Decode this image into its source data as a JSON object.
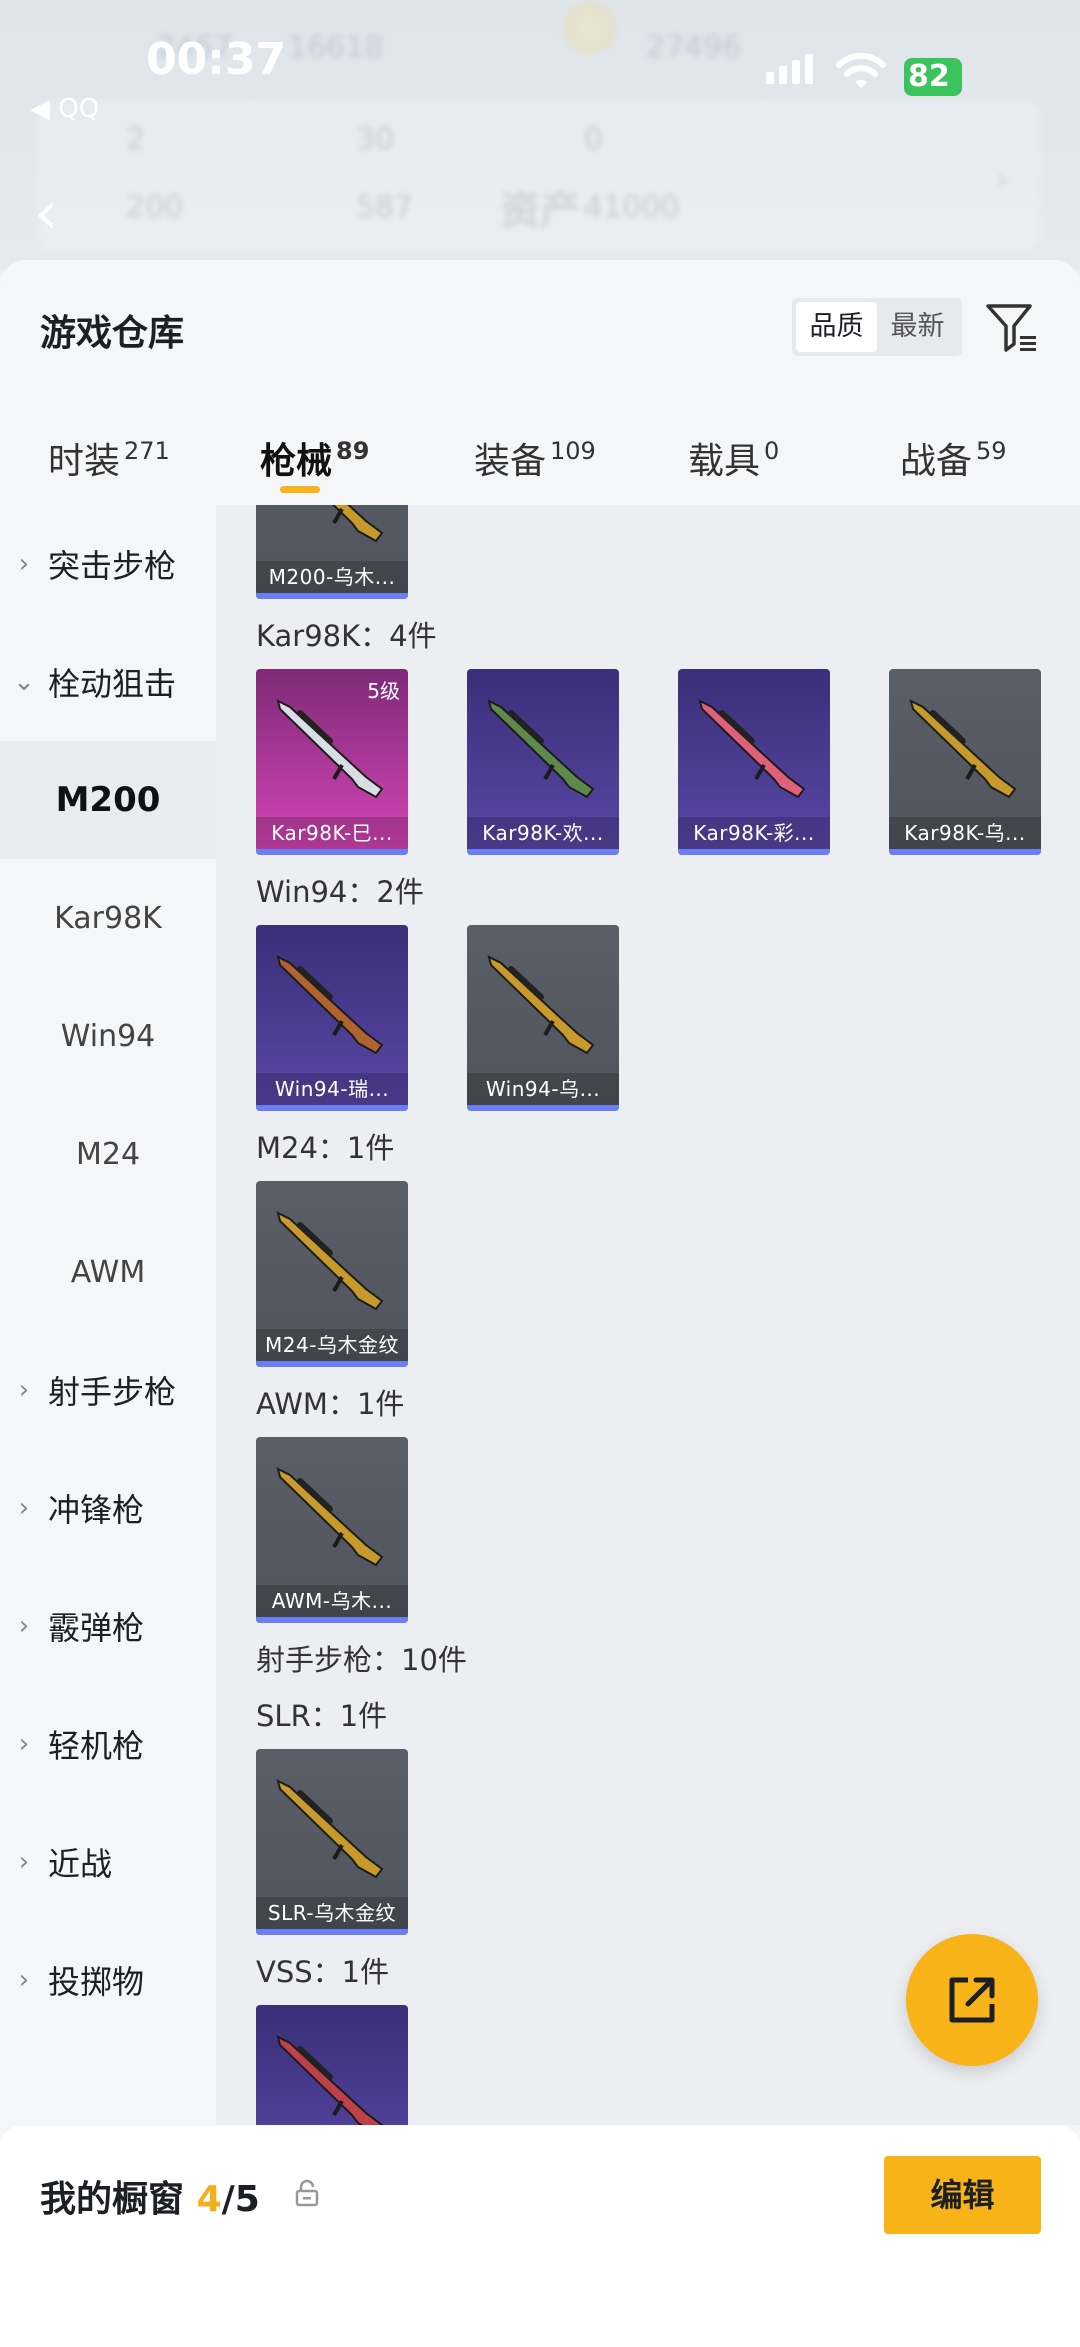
{
  "status_bar": {
    "time": "00:37",
    "back_app": "◀ QQ",
    "battery": "82"
  },
  "background_header": {
    "stats_row1": [
      "2",
      "30",
      "0"
    ],
    "stats_row2": [
      "200",
      "587"
    ],
    "assets_label": "资产",
    "assets_value": "41000",
    "top_values": [
      "2467",
      "16618",
      "27496"
    ]
  },
  "header": {
    "title": "游戏仓库",
    "sort_options": [
      "品质",
      "最新"
    ],
    "active_sort": "品质"
  },
  "tabs": [
    {
      "label": "时装",
      "count": "271"
    },
    {
      "label": "枪械",
      "count": "89"
    },
    {
      "label": "装备",
      "count": "109"
    },
    {
      "label": "载具",
      "count": "0"
    },
    {
      "label": "战备",
      "count": "59"
    }
  ],
  "active_tab": "枪械",
  "sidebar": {
    "items": [
      {
        "label": "突击步枪",
        "type": "category",
        "expanded": false
      },
      {
        "label": "栓动狙击",
        "type": "category",
        "expanded": true
      },
      {
        "label": "M200",
        "type": "sub",
        "selected": true
      },
      {
        "label": "Kar98K",
        "type": "sub"
      },
      {
        "label": "Win94",
        "type": "sub"
      },
      {
        "label": "M24",
        "type": "sub"
      },
      {
        "label": "AWM",
        "type": "sub"
      },
      {
        "label": "射手步枪",
        "type": "category",
        "expanded": false
      },
      {
        "label": "冲锋枪",
        "type": "category",
        "expanded": false
      },
      {
        "label": "霰弹枪",
        "type": "category",
        "expanded": false
      },
      {
        "label": "轻机枪",
        "type": "category",
        "expanded": false
      },
      {
        "label": "近战",
        "type": "category",
        "expanded": false
      },
      {
        "label": "投掷物",
        "type": "category",
        "expanded": false
      }
    ]
  },
  "content": {
    "top_card": {
      "name": "M200-乌木...",
      "rarity": "gray"
    },
    "groups": [
      {
        "label": "Kar98K：4件",
        "items": [
          {
            "name": "Kar98K-巳...",
            "rarity": "pink",
            "level": "5级",
            "gun_color": "#d9dde4"
          },
          {
            "name": "Kar98K-欢...",
            "rarity": "purple",
            "gun_color": "#5d8a4a"
          },
          {
            "name": "Kar98K-彩...",
            "rarity": "purple",
            "gun_color": "#e0607a"
          },
          {
            "name": "Kar98K-乌...",
            "rarity": "gray",
            "gun_color": "#c89a2c"
          }
        ]
      },
      {
        "label": "Win94：2件",
        "items": [
          {
            "name": "Win94-瑞...",
            "rarity": "purple",
            "gun_color": "#b0632e"
          },
          {
            "name": "Win94-乌...",
            "rarity": "gray",
            "gun_color": "#c89a2c"
          }
        ]
      },
      {
        "label": "M24：1件",
        "items": [
          {
            "name": "M24-乌木金纹",
            "rarity": "gray",
            "gun_color": "#c89a2c"
          }
        ]
      },
      {
        "label": "AWM：1件",
        "items": [
          {
            "name": "AWM-乌木...",
            "rarity": "gray",
            "gun_color": "#c89a2c"
          }
        ]
      }
    ],
    "section_label": "射手步枪：10件",
    "groups2": [
      {
        "label": "SLR：1件",
        "items": [
          {
            "name": "SLR-乌木金纹",
            "rarity": "gray",
            "gun_color": "#c89a2c"
          }
        ]
      },
      {
        "label": "VSS：1件",
        "items": [
          {
            "name": "",
            "rarity": "purple",
            "gun_color": "#c0404a"
          }
        ]
      }
    ]
  },
  "bottom_bar": {
    "label": "我的橱窗",
    "count": "4",
    "total": "/5",
    "edit_label": "编辑"
  },
  "colors": {
    "accent": "#f8b318",
    "battery": "#3bc35e",
    "rarity_bar": "#6b7ff2"
  }
}
